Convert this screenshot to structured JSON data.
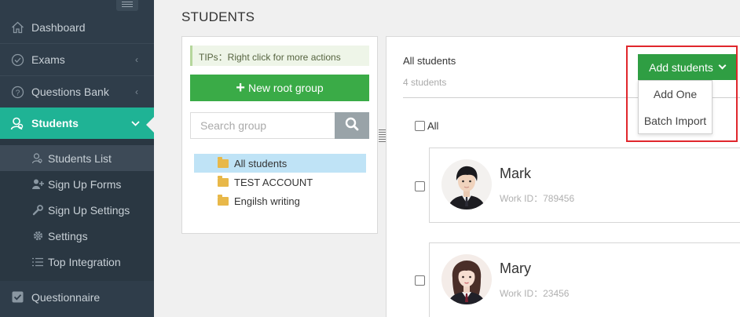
{
  "sidebar": {
    "items": [
      {
        "label": "Dashboard",
        "icon": "home-icon"
      },
      {
        "label": "Exams",
        "icon": "check-circle-icon",
        "arrow": "‹"
      },
      {
        "label": "Questions Bank",
        "icon": "question-circle-icon",
        "arrow": "‹"
      },
      {
        "label": "Students",
        "icon": "students-icon",
        "active": true
      },
      {
        "label": "Questionnaire",
        "icon": "checkbox-icon"
      }
    ],
    "sub_items": [
      {
        "label": "Students List",
        "icon": "user-search-icon",
        "current": true
      },
      {
        "label": "Sign Up Forms",
        "icon": "user-add-icon"
      },
      {
        "label": "Sign Up Settings",
        "icon": "wrench-icon"
      },
      {
        "label": "Settings",
        "icon": "gear-icon"
      },
      {
        "label": "Top Integration",
        "icon": "list-icon"
      }
    ]
  },
  "page": {
    "title": "STUDENTS"
  },
  "groups": {
    "tips": "TIPs：Right click for more actions",
    "new_root_label": "New root group",
    "search_placeholder": "Search group",
    "tree": [
      {
        "label": "All students",
        "selected": true
      },
      {
        "label": "TEST ACCOUNT"
      },
      {
        "label": "Engilsh writing"
      }
    ]
  },
  "students": {
    "header_title": "All students",
    "count": "4 students",
    "add_label": "Add students",
    "dropdown": [
      "Add One",
      "Batch Import"
    ],
    "check_all_label": "All",
    "list": [
      {
        "name": "Mark",
        "work_id": "Work ID：789456"
      },
      {
        "name": "Mary",
        "work_id": "Work ID：23456"
      }
    ]
  },
  "colors": {
    "sidebar_bg": "#2f3d4a",
    "active_teal": "#1fb395",
    "green_button": "#3aab47",
    "highlight_red": "#e0272c"
  }
}
